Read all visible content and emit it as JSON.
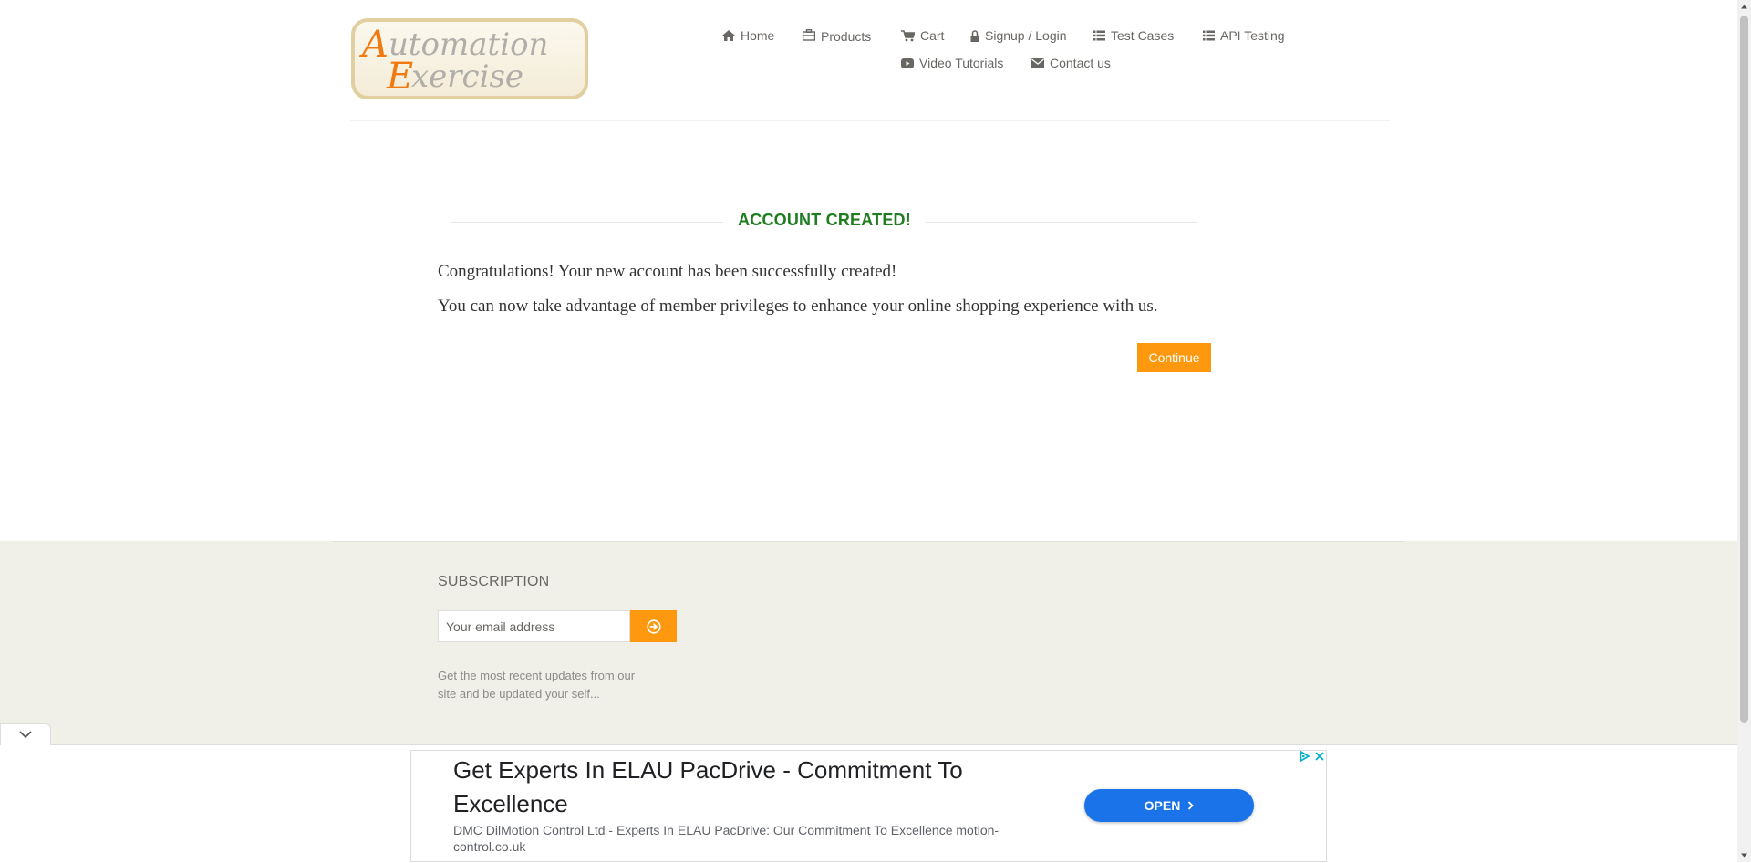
{
  "logo": {
    "line1": "Automation",
    "line2": "Exercise"
  },
  "nav": {
    "home": "Home",
    "products": "Products",
    "cart": "Cart",
    "signup_login": "Signup / Login",
    "test_cases": "Test Cases",
    "api_testing": "API Testing",
    "video_tutorials": "Video Tutorials",
    "contact_us": "Contact us"
  },
  "main": {
    "title": "ACCOUNT CREATED!",
    "line1": "Congratulations! Your new account has been successfully created!",
    "line2": "You can now take advantage of member privileges to enhance your online shopping experience with us.",
    "continue_label": "Continue"
  },
  "footer": {
    "subscription_title": "SUBSCRIPTION",
    "email_placeholder": "Your email address",
    "note": "Get the most recent updates from our site and be updated your self..."
  },
  "ad": {
    "headline": "Get Experts In ELAU PacDrive - Commitment To Excellence",
    "description": "DMC DilMotion Control Ltd - Experts In ELAU PacDrive: Our Commitment To Excellence motion-control.co.uk",
    "open_label": "OPEN"
  },
  "colors": {
    "accent": "#fe980f",
    "success_title": "#1e7d1e",
    "footer_bg": "#f0f0e9",
    "ad_button": "#1a73e8"
  },
  "icons": {
    "home": "home-icon",
    "products": "briefcase-icon",
    "cart": "cart-icon",
    "signup": "lock-icon",
    "test_cases": "list-icon",
    "api_testing": "list-icon",
    "video": "youtube-play-icon",
    "contact": "envelope-icon",
    "subscribe": "circle-arrow-right-icon"
  }
}
